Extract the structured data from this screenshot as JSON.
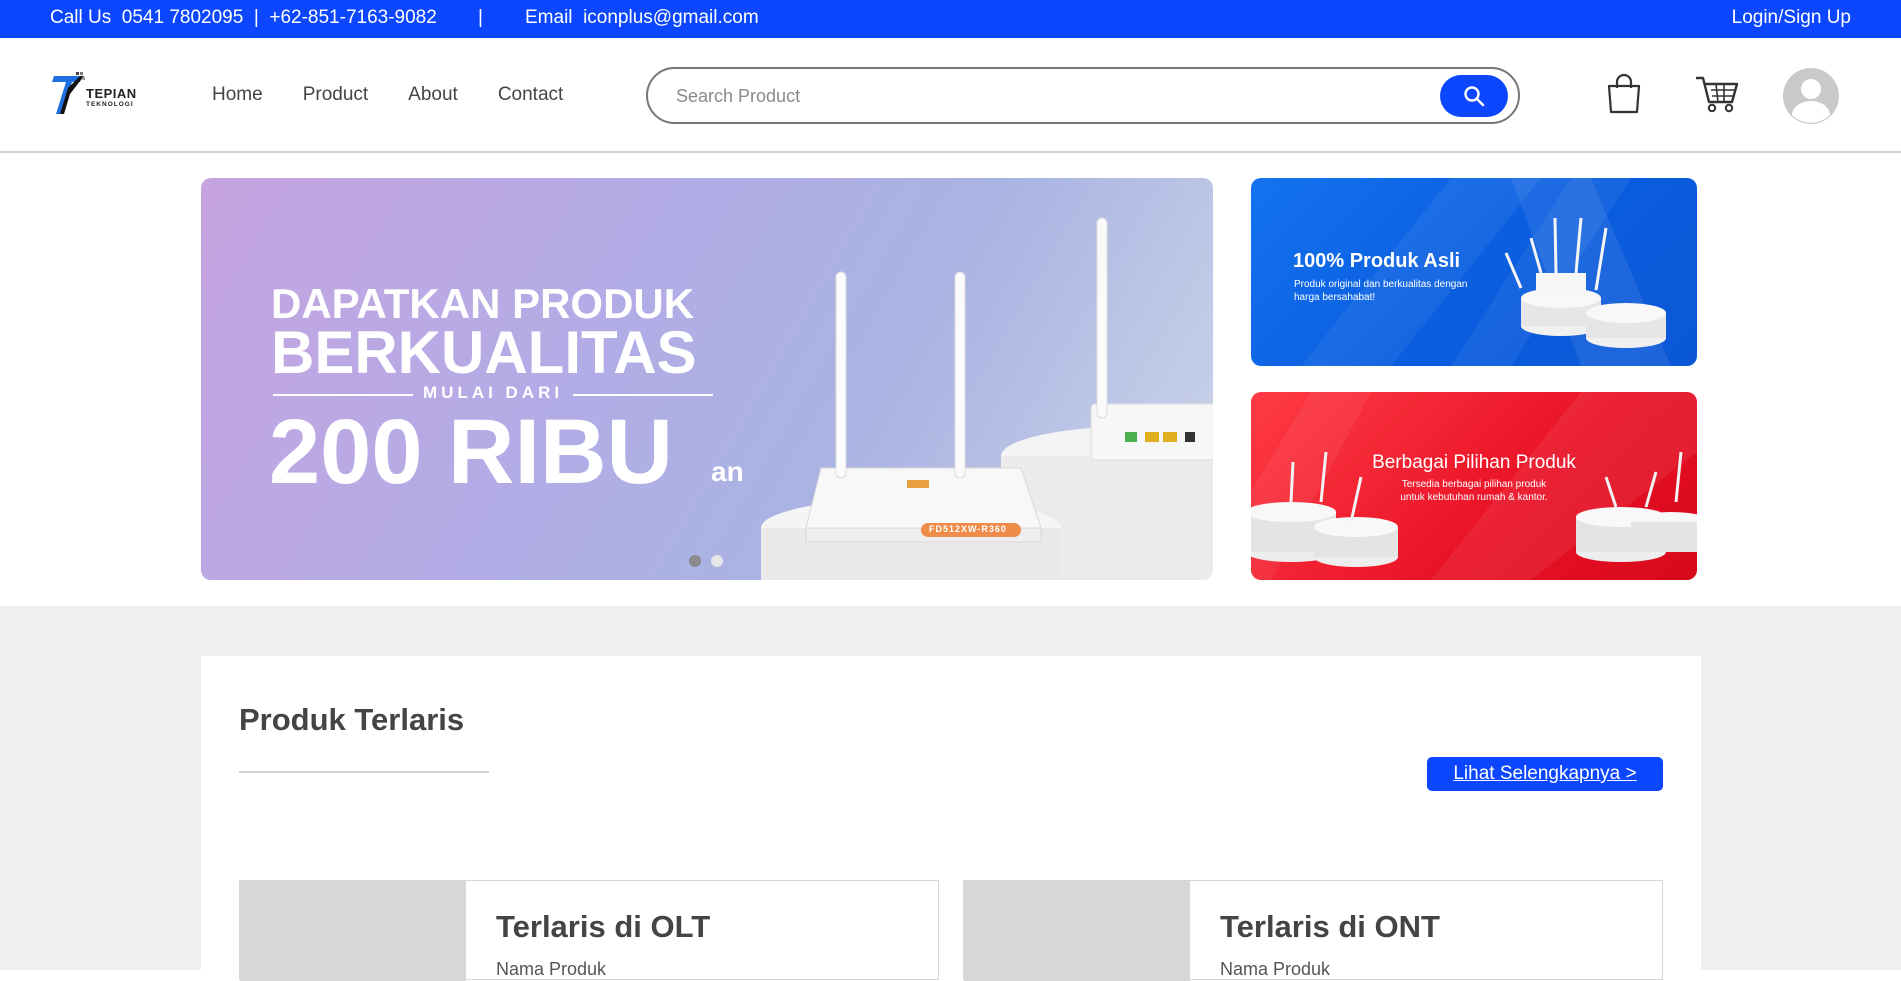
{
  "topbar": {
    "contact": "Call Us  0541 7802095  |  +62-851-7163-9082",
    "separator": "|",
    "email": "Email  iconplus@gmail.com",
    "login": "Login/Sign Up"
  },
  "header": {
    "logo_text": "TEPIAN",
    "logo_subtext": "TEKNOLOGI",
    "nav": [
      "Home",
      "Product",
      "About",
      "Contact"
    ],
    "search_placeholder": "Search Product",
    "icons": [
      "shopping-bag-icon",
      "cart-icon",
      "user-avatar-icon"
    ]
  },
  "hero": {
    "line1": "DAPATKAN PRODUK",
    "line2": "BERKUALITAS",
    "line3": "MULAI DARI",
    "line4": "200 RIBU",
    "suffix": "an",
    "model_label": "FD512XW-R360",
    "slides": 2,
    "active_slide": 1
  },
  "banners": {
    "blue": {
      "title": "100% Produk Asli",
      "subtitle": "Produk original dan berkualitas dengan harga bersahabat!"
    },
    "red": {
      "title": "Berbagai Pilihan Produk",
      "subtitle": "Tersedia berbagai pilihan produk untuk kebutuhan rumah & kantor."
    }
  },
  "bestseller": {
    "title": "Produk Terlaris",
    "see_more": "Lihat Selengkapnya >",
    "categories": [
      {
        "title": "Terlaris di OLT",
        "sub": "Nama Produk"
      },
      {
        "title": "Terlaris di ONT",
        "sub": "Nama Produk"
      }
    ]
  },
  "colors": {
    "primary": "#0c47ff",
    "background_gray": "#efefef"
  }
}
